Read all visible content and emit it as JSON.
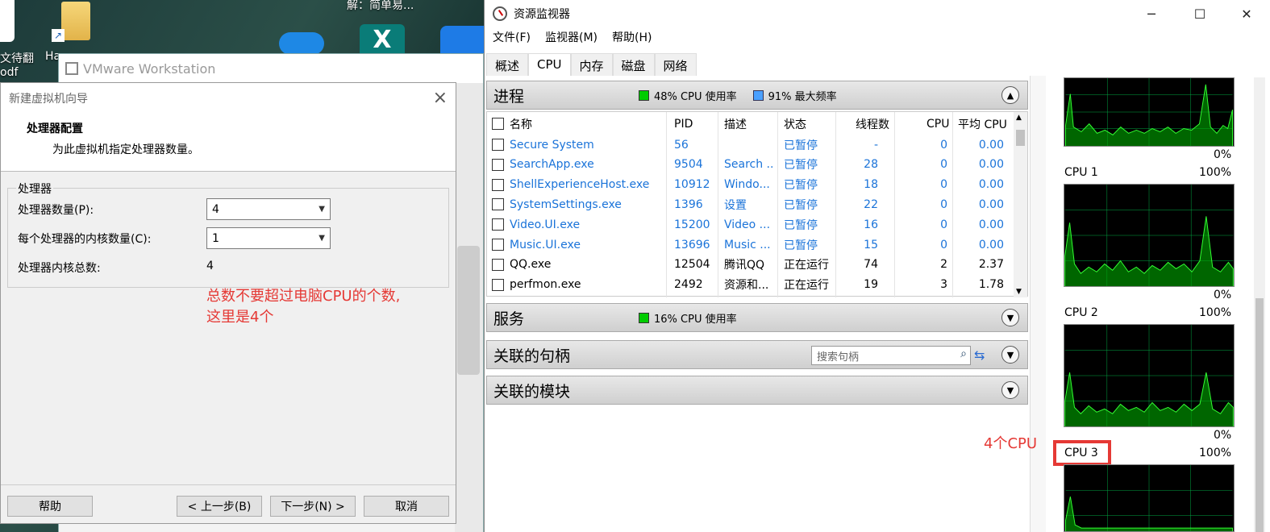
{
  "desktop": {
    "icon_label_1": "文待翻",
    "icon_label_1b": "odf",
    "icon_label_2": "Ha",
    "top_label": "解：简单易..."
  },
  "vmware": {
    "title": "VMware Workstation"
  },
  "wizard": {
    "title": "新建虚拟机向导",
    "header_title": "处理器配置",
    "header_subtitle": "为此虚拟机指定处理器数量。",
    "group_title": "处理器",
    "processor_count_label": "处理器数量(P):",
    "processor_count_value": "4",
    "cores_label": "每个处理器的内核数量(C):",
    "cores_value": "1",
    "total_label": "处理器内核总数:",
    "total_value": "4",
    "annotation_line1": "总数不要超过电脑CPU的个数,",
    "annotation_line2": "这里是4个",
    "help_button": "帮助",
    "back_button": "< 上一步(B)",
    "next_button": "下一步(N) >",
    "cancel_button": "取消"
  },
  "resmon": {
    "title": "资源监视器",
    "menu": [
      "文件(F)",
      "监视器(M)",
      "帮助(H)"
    ],
    "tabs": [
      "概述",
      "CPU",
      "内存",
      "磁盘",
      "网络"
    ],
    "process_section": {
      "title": "进程",
      "cpu_usage": "48% CPU 使用率",
      "max_freq": "91% 最大频率",
      "columns": [
        "名称",
        "PID",
        "描述",
        "状态",
        "线程数",
        "CPU",
        "平均 CPU"
      ],
      "rows": [
        {
          "name": "Secure System",
          "pid": "56",
          "desc": "",
          "status": "已暂停",
          "threads": "-",
          "cpu": "0",
          "avg": "0.00",
          "suspended": true
        },
        {
          "name": "SearchApp.exe",
          "pid": "9504",
          "desc": "Search ...",
          "status": "已暂停",
          "threads": "28",
          "cpu": "0",
          "avg": "0.00",
          "suspended": true
        },
        {
          "name": "ShellExperienceHost.exe",
          "pid": "10912",
          "desc": "Windo...",
          "status": "已暂停",
          "threads": "18",
          "cpu": "0",
          "avg": "0.00",
          "suspended": true
        },
        {
          "name": "SystemSettings.exe",
          "pid": "1396",
          "desc": "设置",
          "status": "已暂停",
          "threads": "22",
          "cpu": "0",
          "avg": "0.00",
          "suspended": true
        },
        {
          "name": "Video.UI.exe",
          "pid": "15200",
          "desc": "Video ...",
          "status": "已暂停",
          "threads": "16",
          "cpu": "0",
          "avg": "0.00",
          "suspended": true
        },
        {
          "name": "Music.UI.exe",
          "pid": "13696",
          "desc": "Music ...",
          "status": "已暂停",
          "threads": "15",
          "cpu": "0",
          "avg": "0.00",
          "suspended": true
        },
        {
          "name": "QQ.exe",
          "pid": "12504",
          "desc": "腾讯QQ",
          "status": "正在运行",
          "threads": "74",
          "cpu": "2",
          "avg": "2.37",
          "suspended": false
        },
        {
          "name": "perfmon.exe",
          "pid": "2492",
          "desc": "资源和...",
          "status": "正在运行",
          "threads": "19",
          "cpu": "3",
          "avg": "1.78",
          "suspended": false
        }
      ]
    },
    "services_section": {
      "title": "服务",
      "cpu_usage": "16% CPU 使用率"
    },
    "handles_section": {
      "title": "关联的句柄",
      "search_placeholder": "搜索句柄"
    },
    "modules_section": {
      "title": "关联的模块"
    },
    "graphs": {
      "top_zero": "0%",
      "cpus": [
        {
          "label": "CPU 1",
          "max": "100%",
          "min": "0%"
        },
        {
          "label": "CPU 2",
          "max": "100%",
          "min": "0%"
        },
        {
          "label": "CPU 3",
          "max": "100%"
        }
      ],
      "annotation": "4个CPU"
    }
  },
  "colors": {
    "annotation_red": "#e53935",
    "link_blue": "#1a73d9",
    "graph_green": "#00c800"
  }
}
